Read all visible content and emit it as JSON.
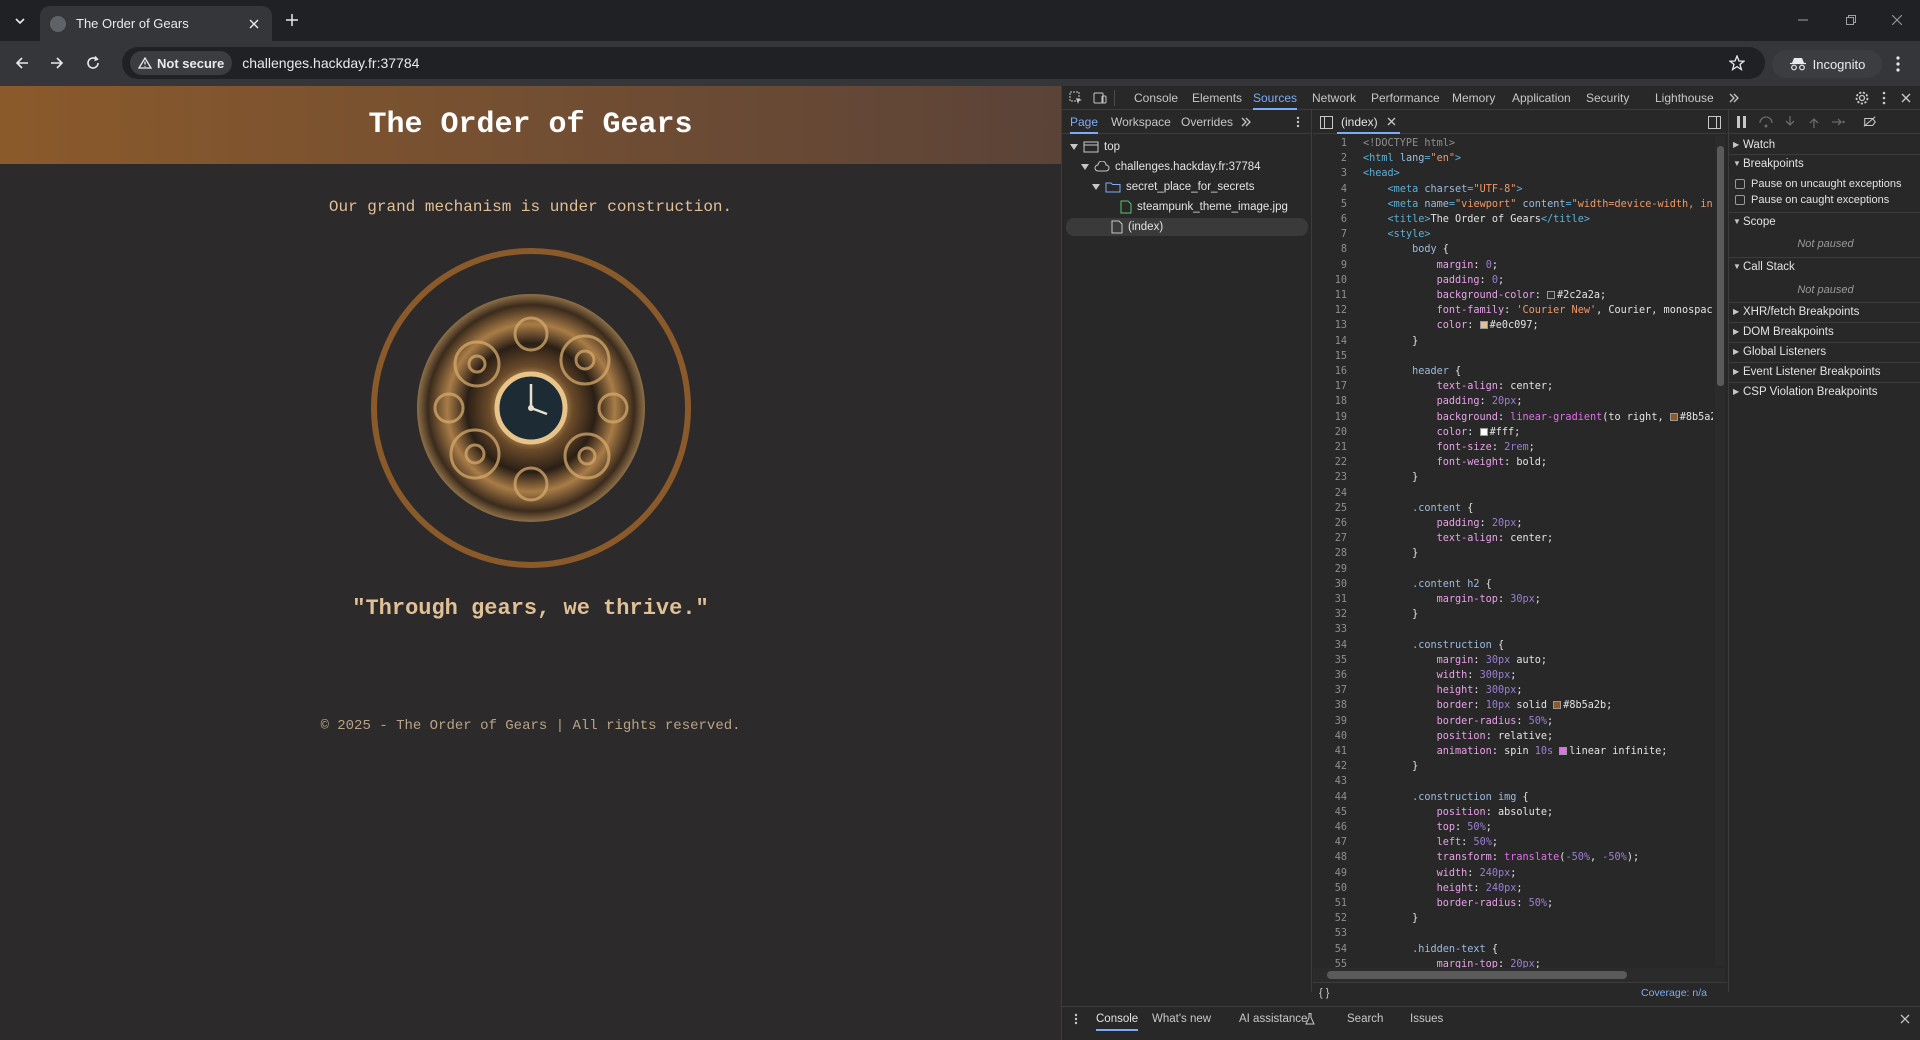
{
  "browser": {
    "tab_title": "The Order of Gears",
    "not_secure": "Not secure",
    "url": "challenges.hackday.fr:37784",
    "incognito": "Incognito"
  },
  "page": {
    "header": "The Order of Gears",
    "message": "Our grand mechanism is under construction.",
    "quote": "\"Through gears, we thrive.\"",
    "footer": "© 2025 - The Order of Gears | All rights reserved.",
    "colors": {
      "background": "#2c2a2a",
      "text": "#e0c097",
      "accent": "#8b5a2b"
    }
  },
  "devtools": {
    "tabs": [
      "Console",
      "Elements",
      "Sources",
      "Network",
      "Performance",
      "Memory",
      "Application",
      "Security",
      "Lighthouse"
    ],
    "active_tab": "Sources",
    "subtabs": [
      "Page",
      "Workspace",
      "Overrides"
    ],
    "tree": {
      "top": "top",
      "origin": "challenges.hackday.fr:37784",
      "folder": "secret_place_for_secrets",
      "file": "steampunk_theme_image.jpg",
      "index": "(index)"
    },
    "editor_tab": "(index)",
    "coverage": "Coverage: n/a",
    "code_lines": [
      [
        [
          "cm",
          "<!DOCTYPE html>"
        ]
      ],
      [
        [
          "tag",
          "<html "
        ],
        [
          "attr",
          "lang"
        ],
        [
          "tag",
          "="
        ],
        [
          "str",
          "\"en\""
        ],
        [
          "tag",
          ">"
        ]
      ],
      [
        [
          "tag",
          "<head>"
        ]
      ],
      [
        [
          "tx",
          "    "
        ],
        [
          "tag",
          "<meta "
        ],
        [
          "attr",
          "charset"
        ],
        [
          "tag",
          "="
        ],
        [
          "str",
          "\"UTF-8\""
        ],
        [
          "tag",
          ">"
        ]
      ],
      [
        [
          "tx",
          "    "
        ],
        [
          "tag",
          "<meta "
        ],
        [
          "attr",
          "name"
        ],
        [
          "tag",
          "="
        ],
        [
          "str",
          "\"viewport\""
        ],
        [
          "tag",
          " "
        ],
        [
          "attr",
          "content"
        ],
        [
          "tag",
          "="
        ],
        [
          "str",
          "\"width=device-width, ini"
        ]
      ],
      [
        [
          "tx",
          "    "
        ],
        [
          "tag",
          "<title>"
        ],
        [
          "tx",
          "The Order of Gears"
        ],
        [
          "tag",
          "</title>"
        ]
      ],
      [
        [
          "tx",
          "    "
        ],
        [
          "tag",
          "<style>"
        ]
      ],
      [
        [
          "tx",
          "        "
        ],
        [
          "sel",
          "body"
        ],
        [
          "tx",
          " {"
        ]
      ],
      [
        [
          "tx",
          "            "
        ],
        [
          "prop",
          "margin"
        ],
        [
          "tx",
          ": "
        ],
        [
          "num",
          "0"
        ],
        [
          "tx",
          ";"
        ]
      ],
      [
        [
          "tx",
          "            "
        ],
        [
          "prop",
          "padding"
        ],
        [
          "tx",
          ": "
        ],
        [
          "num",
          "0"
        ],
        [
          "tx",
          ";"
        ]
      ],
      [
        [
          "tx",
          "            "
        ],
        [
          "prop",
          "background-color"
        ],
        [
          "tx",
          ": "
        ],
        [
          "sw",
          "#2c2a2a"
        ],
        [
          "tx",
          "#2c2a2a;"
        ]
      ],
      [
        [
          "tx",
          "            "
        ],
        [
          "prop",
          "font-family"
        ],
        [
          "tx",
          ": "
        ],
        [
          "str",
          "'Courier New'"
        ],
        [
          "tx",
          ", Courier, monospace"
        ]
      ],
      [
        [
          "tx",
          "            "
        ],
        [
          "prop",
          "color"
        ],
        [
          "tx",
          ": "
        ],
        [
          "sw",
          "#e0c097"
        ],
        [
          "tx",
          "#e0c097;"
        ]
      ],
      [
        [
          "tx",
          "        }"
        ]
      ],
      [
        [
          "tx",
          ""
        ]
      ],
      [
        [
          "tx",
          "        "
        ],
        [
          "sel",
          "header"
        ],
        [
          "tx",
          " {"
        ]
      ],
      [
        [
          "tx",
          "            "
        ],
        [
          "prop",
          "text-align"
        ],
        [
          "tx",
          ": center;"
        ]
      ],
      [
        [
          "tx",
          "            "
        ],
        [
          "prop",
          "padding"
        ],
        [
          "tx",
          ": "
        ],
        [
          "num",
          "20px"
        ],
        [
          "tx",
          ";"
        ]
      ],
      [
        [
          "tx",
          "            "
        ],
        [
          "prop",
          "background"
        ],
        [
          "tx",
          ": "
        ],
        [
          "kw",
          "linear-gradient"
        ],
        [
          "tx",
          "(to right, "
        ],
        [
          "sw",
          "#8b5a2b"
        ],
        [
          "tx",
          "#8b5a2"
        ]
      ],
      [
        [
          "tx",
          "            "
        ],
        [
          "prop",
          "color"
        ],
        [
          "tx",
          ": "
        ],
        [
          "sw",
          "#ffffff"
        ],
        [
          "tx",
          "#fff;"
        ]
      ],
      [
        [
          "tx",
          "            "
        ],
        [
          "prop",
          "font-size"
        ],
        [
          "tx",
          ": "
        ],
        [
          "num",
          "2rem"
        ],
        [
          "tx",
          ";"
        ]
      ],
      [
        [
          "tx",
          "            "
        ],
        [
          "prop",
          "font-weight"
        ],
        [
          "tx",
          ": bold;"
        ]
      ],
      [
        [
          "tx",
          "        }"
        ]
      ],
      [
        [
          "tx",
          ""
        ]
      ],
      [
        [
          "tx",
          "        "
        ],
        [
          "sel",
          ".content"
        ],
        [
          "tx",
          " {"
        ]
      ],
      [
        [
          "tx",
          "            "
        ],
        [
          "prop",
          "padding"
        ],
        [
          "tx",
          ": "
        ],
        [
          "num",
          "20px"
        ],
        [
          "tx",
          ";"
        ]
      ],
      [
        [
          "tx",
          "            "
        ],
        [
          "prop",
          "text-align"
        ],
        [
          "tx",
          ": center;"
        ]
      ],
      [
        [
          "tx",
          "        }"
        ]
      ],
      [
        [
          "tx",
          ""
        ]
      ],
      [
        [
          "tx",
          "        "
        ],
        [
          "sel",
          ".content h2"
        ],
        [
          "tx",
          " {"
        ]
      ],
      [
        [
          "tx",
          "            "
        ],
        [
          "prop",
          "margin-top"
        ],
        [
          "tx",
          ": "
        ],
        [
          "num",
          "30px"
        ],
        [
          "tx",
          ";"
        ]
      ],
      [
        [
          "tx",
          "        }"
        ]
      ],
      [
        [
          "tx",
          ""
        ]
      ],
      [
        [
          "tx",
          "        "
        ],
        [
          "sel",
          ".construction"
        ],
        [
          "tx",
          " {"
        ]
      ],
      [
        [
          "tx",
          "            "
        ],
        [
          "prop",
          "margin"
        ],
        [
          "tx",
          ": "
        ],
        [
          "num",
          "30px"
        ],
        [
          "tx",
          " auto;"
        ]
      ],
      [
        [
          "tx",
          "            "
        ],
        [
          "prop",
          "width"
        ],
        [
          "tx",
          ": "
        ],
        [
          "num",
          "300px"
        ],
        [
          "tx",
          ";"
        ]
      ],
      [
        [
          "tx",
          "            "
        ],
        [
          "prop",
          "height"
        ],
        [
          "tx",
          ": "
        ],
        [
          "num",
          "300px"
        ],
        [
          "tx",
          ";"
        ]
      ],
      [
        [
          "tx",
          "            "
        ],
        [
          "prop",
          "border"
        ],
        [
          "tx",
          ": "
        ],
        [
          "num",
          "10px"
        ],
        [
          "tx",
          " solid "
        ],
        [
          "sw",
          "#8b5a2b"
        ],
        [
          "tx",
          "#8b5a2b;"
        ]
      ],
      [
        [
          "tx",
          "            "
        ],
        [
          "prop",
          "border-radius"
        ],
        [
          "tx",
          ": "
        ],
        [
          "num",
          "50%"
        ],
        [
          "tx",
          ";"
        ]
      ],
      [
        [
          "tx",
          "            "
        ],
        [
          "prop",
          "position"
        ],
        [
          "tx",
          ": relative;"
        ]
      ],
      [
        [
          "tx",
          "            "
        ],
        [
          "prop",
          "animation"
        ],
        [
          "tx",
          ": spin "
        ],
        [
          "num",
          "10s"
        ],
        [
          "tx",
          " "
        ],
        [
          "sw",
          "#e36eec"
        ],
        [
          "tx",
          "linear infinite;"
        ]
      ],
      [
        [
          "tx",
          "        }"
        ]
      ],
      [
        [
          "tx",
          ""
        ]
      ],
      [
        [
          "tx",
          "        "
        ],
        [
          "sel",
          ".construction img"
        ],
        [
          "tx",
          " {"
        ]
      ],
      [
        [
          "tx",
          "            "
        ],
        [
          "prop",
          "position"
        ],
        [
          "tx",
          ": absolute;"
        ]
      ],
      [
        [
          "tx",
          "            "
        ],
        [
          "prop",
          "top"
        ],
        [
          "tx",
          ": "
        ],
        [
          "num",
          "50%"
        ],
        [
          "tx",
          ";"
        ]
      ],
      [
        [
          "tx",
          "            "
        ],
        [
          "prop",
          "left"
        ],
        [
          "tx",
          ": "
        ],
        [
          "num",
          "50%"
        ],
        [
          "tx",
          ";"
        ]
      ],
      [
        [
          "tx",
          "            "
        ],
        [
          "prop",
          "transform"
        ],
        [
          "tx",
          ": "
        ],
        [
          "kw",
          "translate"
        ],
        [
          "tx",
          "("
        ],
        [
          "num",
          "-50%"
        ],
        [
          "tx",
          ", "
        ],
        [
          "num",
          "-50%"
        ],
        [
          "tx",
          ");"
        ]
      ],
      [
        [
          "tx",
          "            "
        ],
        [
          "prop",
          "width"
        ],
        [
          "tx",
          ": "
        ],
        [
          "num",
          "240px"
        ],
        [
          "tx",
          ";"
        ]
      ],
      [
        [
          "tx",
          "            "
        ],
        [
          "prop",
          "height"
        ],
        [
          "tx",
          ": "
        ],
        [
          "num",
          "240px"
        ],
        [
          "tx",
          ";"
        ]
      ],
      [
        [
          "tx",
          "            "
        ],
        [
          "prop",
          "border-radius"
        ],
        [
          "tx",
          ": "
        ],
        [
          "num",
          "50%"
        ],
        [
          "tx",
          ";"
        ]
      ],
      [
        [
          "tx",
          "        }"
        ]
      ],
      [
        [
          "tx",
          ""
        ]
      ],
      [
        [
          "tx",
          "        "
        ],
        [
          "sel",
          ".hidden-text"
        ],
        [
          "tx",
          " {"
        ]
      ],
      [
        [
          "tx",
          "            "
        ],
        [
          "prop",
          "margin-top"
        ],
        [
          "tx",
          ": "
        ],
        [
          "num",
          "20px"
        ],
        [
          "tx",
          ";"
        ]
      ]
    ],
    "right_panel": {
      "watch": "Watch",
      "breakpoints": "Breakpoints",
      "pause_uncaught": "Pause on uncaught exceptions",
      "pause_caught": "Pause on caught exceptions",
      "scope": "Scope",
      "not_paused": "Not paused",
      "call_stack": "Call Stack",
      "not_paused_2": "Not paused",
      "xhr": "XHR/fetch Breakpoints",
      "dom": "DOM Breakpoints",
      "global": "Global Listeners",
      "event": "Event Listener Breakpoints",
      "csp": "CSP Violation Breakpoints"
    },
    "drawer": [
      "Console",
      "What's new",
      "AI assistance",
      "Search",
      "Issues"
    ]
  }
}
